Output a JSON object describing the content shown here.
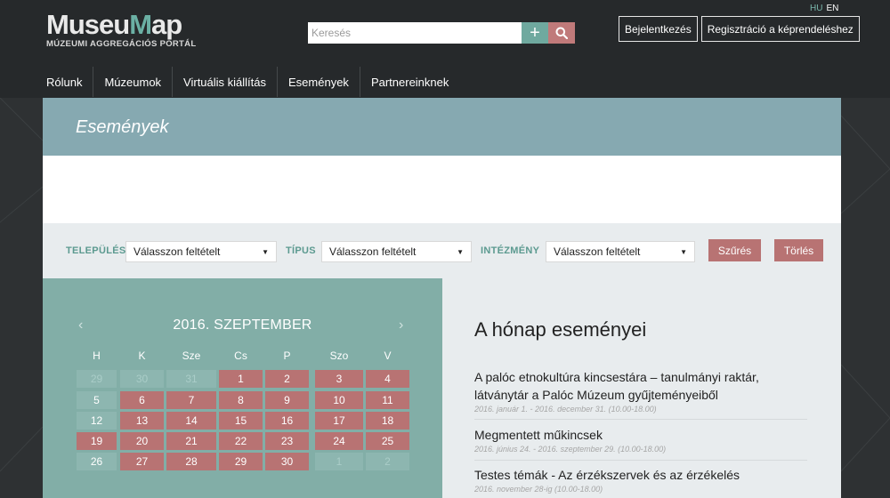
{
  "header": {
    "logo_part1": "Museu",
    "logo_part2": "M",
    "logo_part3": "ap",
    "logo_subtitle": "MÚZEUMI AGGREGÁCIÓS PORTÁL",
    "search_placeholder": "Keresés",
    "lang_hu": "HU",
    "lang_en": "EN",
    "login_label": "Bejelentkezés",
    "register_label": "Regisztráció a képrendeléshez"
  },
  "nav": {
    "items": [
      "Rólunk",
      "Múzeumok",
      "Virtuális kiállítás",
      "Események",
      "Partnereinknek"
    ]
  },
  "page": {
    "title": "Események"
  },
  "filter": {
    "settlement_label": "TELEPÜLÉS",
    "settlement_value": "Válasszon feltételt",
    "type_label": "TÍPUS",
    "type_value": "Válasszon feltételt",
    "institution_label": "INTÉZMÉNY",
    "institution_value": "Válasszon feltételt",
    "filter_button": "Szűrés",
    "clear_button": "Törlés"
  },
  "calendar": {
    "title": "2016. SZEPTEMBER",
    "prev": "‹",
    "next": "›",
    "weekdays": [
      "H",
      "K",
      "Sze",
      "Cs",
      "P",
      "Szo",
      "V"
    ],
    "weeks": [
      [
        {
          "d": "29",
          "s": "muted"
        },
        {
          "d": "30",
          "s": "muted"
        },
        {
          "d": "31",
          "s": "muted"
        },
        {
          "d": "1",
          "s": "event"
        },
        {
          "d": "2",
          "s": "event"
        },
        {
          "d": "3",
          "s": "event"
        },
        {
          "d": "4",
          "s": "event"
        }
      ],
      [
        {
          "d": "5",
          "s": "plain"
        },
        {
          "d": "6",
          "s": "event"
        },
        {
          "d": "7",
          "s": "event"
        },
        {
          "d": "8",
          "s": "event"
        },
        {
          "d": "9",
          "s": "event"
        },
        {
          "d": "10",
          "s": "event"
        },
        {
          "d": "11",
          "s": "event"
        }
      ],
      [
        {
          "d": "12",
          "s": "plain"
        },
        {
          "d": "13",
          "s": "event"
        },
        {
          "d": "14",
          "s": "event"
        },
        {
          "d": "15",
          "s": "event"
        },
        {
          "d": "16",
          "s": "event"
        },
        {
          "d": "17",
          "s": "event"
        },
        {
          "d": "18",
          "s": "event"
        }
      ],
      [
        {
          "d": "19",
          "s": "event"
        },
        {
          "d": "20",
          "s": "event"
        },
        {
          "d": "21",
          "s": "event"
        },
        {
          "d": "22",
          "s": "event"
        },
        {
          "d": "23",
          "s": "event"
        },
        {
          "d": "24",
          "s": "event"
        },
        {
          "d": "25",
          "s": "event"
        }
      ],
      [
        {
          "d": "26",
          "s": "plain"
        },
        {
          "d": "27",
          "s": "event"
        },
        {
          "d": "28",
          "s": "event"
        },
        {
          "d": "29",
          "s": "event"
        },
        {
          "d": "30",
          "s": "event"
        },
        {
          "d": "1",
          "s": "muted"
        },
        {
          "d": "2",
          "s": "muted"
        }
      ]
    ]
  },
  "events": {
    "title": "A hónap eseményei",
    "items": [
      {
        "name": "A palóc etnokultúra kincsestára – tanulmányi raktár, látványtár a Palóc Múzeum gyűjteményeiből",
        "date": "2016. január 1. - 2016. december 31. (10.00-18.00)"
      },
      {
        "name": "Megmentett műkincsek",
        "date": "2016. június 24. - 2016. szeptember 29. (10.00-18.00)"
      },
      {
        "name": "Testes témák - Az érzékszervek és az érzékelés",
        "date": "2016. november 28-ig (10.00-18.00)"
      }
    ]
  },
  "colors": {
    "header_bg": "#26292b",
    "accent_teal": "#6bb0a4",
    "event_day": "#b87373",
    "title_bar": "#86a9b1",
    "calendar_bg": "#82aea7"
  }
}
